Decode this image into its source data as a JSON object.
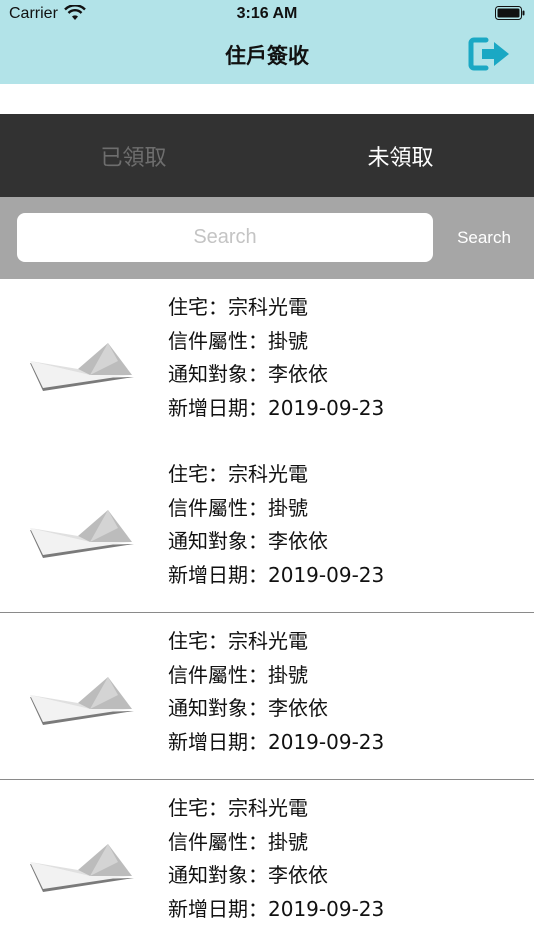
{
  "status_bar": {
    "carrier": "Carrier",
    "time": "3:16 AM"
  },
  "header": {
    "title": "住戶簽收",
    "logout_icon": "logout-arrow-icon",
    "accent": "#1aa8c4"
  },
  "tabs": [
    {
      "label": "已領取",
      "active": false
    },
    {
      "label": "未領取",
      "active": true
    }
  ],
  "search": {
    "placeholder": "Search",
    "value": "",
    "button_label": "Search"
  },
  "items": [
    {
      "residence": "住宅：宗科光電",
      "type": "信件屬性：掛號",
      "recipient": "通知對象：李依依",
      "date": "新增日期：2019-09-23"
    },
    {
      "residence": "住宅：宗科光電",
      "type": "信件屬性：掛號",
      "recipient": "通知對象：李依依",
      "date": "新增日期：2019-09-23"
    },
    {
      "residence": "住宅：宗科光電",
      "type": "信件屬性：掛號",
      "recipient": "通知對象：李依依",
      "date": "新增日期：2019-09-23"
    },
    {
      "residence": "住宅：宗科光電",
      "type": "信件屬性：掛號",
      "recipient": "通知對象：李依依",
      "date": "新增日期：2019-09-23"
    }
  ]
}
